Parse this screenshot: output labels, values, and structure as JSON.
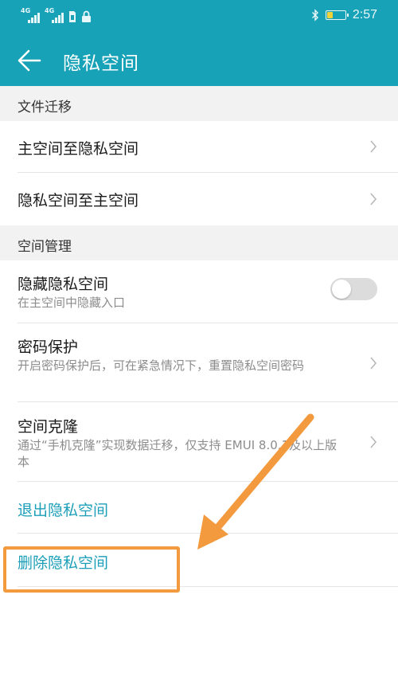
{
  "status_bar": {
    "signal_label_1": "4G",
    "signal_label_2": "4G",
    "time": "2:57",
    "battery_level": 0.3,
    "icons": [
      "signal-icon",
      "signal-icon",
      "sim-icon",
      "lock-icon",
      "bluetooth-icon",
      "battery-icon"
    ]
  },
  "header": {
    "title": "隐私空间",
    "back_icon": "back-arrow-icon"
  },
  "sections": {
    "file_migration": {
      "title": "文件迁移",
      "items": [
        {
          "title": "主空间至隐私空间"
        },
        {
          "title": "隐私空间至主空间"
        }
      ]
    },
    "space_management": {
      "title": "空间管理",
      "hide": {
        "title": "隐藏隐私空间",
        "subtitle": "在主空间中隐藏入口",
        "enabled": false
      },
      "password": {
        "title": "密码保护",
        "subtitle": "开启密码保护后，可在紧急情况下，重置隐私空间密码"
      },
      "clone": {
        "title": "空间克隆",
        "subtitle": "通过“手机克隆”实现数据迁移，仅支持 EMUI 8.0.1及以上版本"
      }
    }
  },
  "actions": {
    "exit": "退出隐私空间",
    "delete": "删除隐私空间"
  },
  "colors": {
    "header_bg": "#17a2b8",
    "link": "#1b9fb8",
    "annotation": "#f39a3e",
    "toggle_off": "#dcdcdc",
    "battery_fill": "#f3d23a"
  }
}
